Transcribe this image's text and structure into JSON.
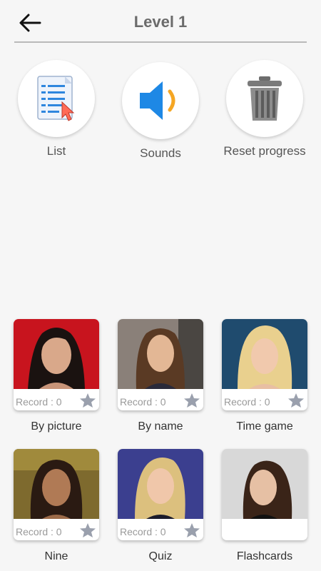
{
  "header": {
    "title": "Level 1"
  },
  "tools": [
    {
      "label": "List"
    },
    {
      "label": "Sounds"
    },
    {
      "label": "Reset progress"
    }
  ],
  "modes": [
    {
      "label": "By picture",
      "record": "Record : 0"
    },
    {
      "label": "By name",
      "record": "Record : 0"
    },
    {
      "label": "Time game",
      "record": "Record : 0"
    },
    {
      "label": "Nine",
      "record": "Record : 0"
    },
    {
      "label": "Quiz",
      "record": "Record : 0"
    },
    {
      "label": "Flashcards",
      "record": ""
    }
  ],
  "colors": {
    "title": "#6b6b6b",
    "divider": "#b9b9b9",
    "sound_blue": "#1e88e5",
    "sound_orange": "#f5a623",
    "star": "#9aa0ad"
  }
}
